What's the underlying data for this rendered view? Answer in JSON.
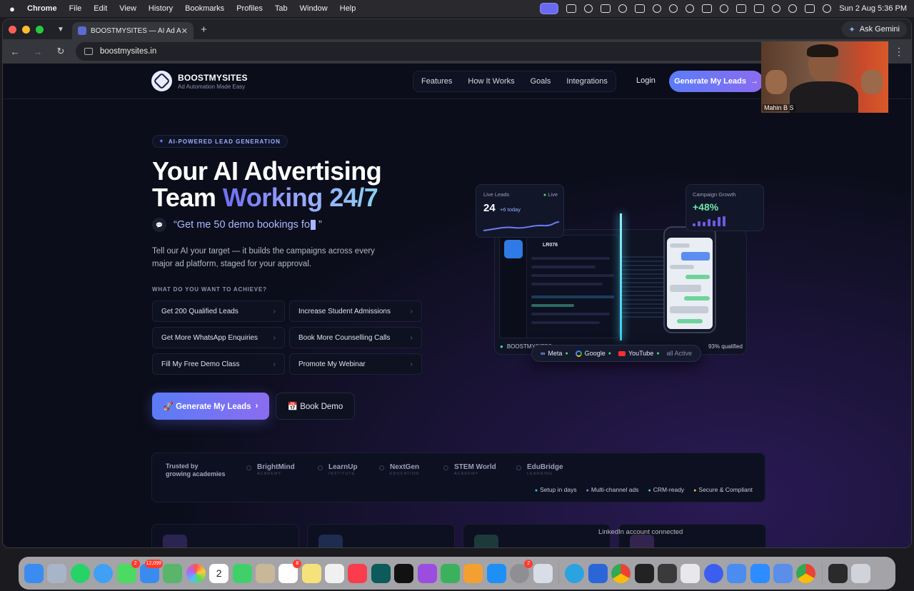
{
  "menubar": {
    "app": "Chrome",
    "items": [
      "File",
      "Edit",
      "View",
      "History",
      "Bookmarks",
      "Profiles",
      "Tab",
      "Window",
      "Help"
    ],
    "datetime": "Sun 2 Aug  5:36 PM"
  },
  "browser": {
    "tab_title": "BOOSTMYSITES — AI Ad Aut",
    "url": "boostmysites.in",
    "ask_gemini": "Ask Gemini"
  },
  "site": {
    "logo_name": "BOOSTMYSITES",
    "logo_tagline": "Ad Automation Made Easy",
    "nav": [
      "Features",
      "How It Works",
      "Goals",
      "Integrations"
    ],
    "login": "Login",
    "nav_cta": "Generate My Leads",
    "badge": "AI-POWERED LEAD GENERATION",
    "headline_1": "Your AI Advertising",
    "headline_2a": "Team ",
    "headline_2b": "Working 24/7",
    "prompt_open": "“Get me 50 demo bookings fo",
    "prompt_close": " ”",
    "lead": "Tell our AI your target — it builds the campaigns across every major ad platform, staged for your approval.",
    "question": "WHAT DO YOU WANT TO ACHIEVE?",
    "goals": [
      "Get 200 Qualified Leads",
      "Increase Student Admissions",
      "Get More WhatsApp Enquiries",
      "Book More Counselling Calls",
      "Fill My Free Demo Class",
      "Promote My Webinar"
    ],
    "primary_cta": "🚀 Generate My Leads",
    "secondary_cta": "📅 Book Demo",
    "live_leads": {
      "label": "Live Leads",
      "live": "Live",
      "value": "24",
      "delta": "+6 today"
    },
    "campaign_growth": {
      "label": "Campaign Growth",
      "value": "+48%",
      "bars": [
        0.3,
        0.5,
        0.4,
        0.7,
        0.6,
        0.9,
        1.0
      ]
    },
    "dashboard_code": "LR076",
    "status_text": "BOOSTMYSITES",
    "status_right": "93% qualified",
    "platforms": [
      "Meta",
      "Google",
      "YouTube"
    ],
    "platforms_status": "all Active",
    "trusted_label_1": "Trusted by",
    "trusted_label_2": "growing academies",
    "brands": [
      {
        "name": "BrightMind",
        "sub": "ACADEMY"
      },
      {
        "name": "LearnUp",
        "sub": "INSTITUTE"
      },
      {
        "name": "NextGen",
        "sub": "EDUCATION"
      },
      {
        "name": "STEM World",
        "sub": "ACADEMY"
      },
      {
        "name": "EduBridge",
        "sub": "LEARNING"
      }
    ],
    "features": [
      "Setup in days",
      "Multi-channel ads",
      "CRM-ready",
      "Secure & Compliant"
    ],
    "feature_colors": [
      "#38bdf8",
      "#8b7cf6",
      "#4ade80",
      "#f5b93a"
    ]
  },
  "notification": "LinkedIn account connected",
  "zoom": {
    "participant": "Mahin B S"
  },
  "dock": {
    "badges": {
      "mail": "12,099",
      "whatsapp_like": "2",
      "reminders": "8",
      "settings": "2"
    },
    "calendar_day": "2"
  },
  "colors": {
    "accent": "#6b7cf7",
    "accent2": "#8b6cf0",
    "page_bg": "#0b0d1a"
  }
}
